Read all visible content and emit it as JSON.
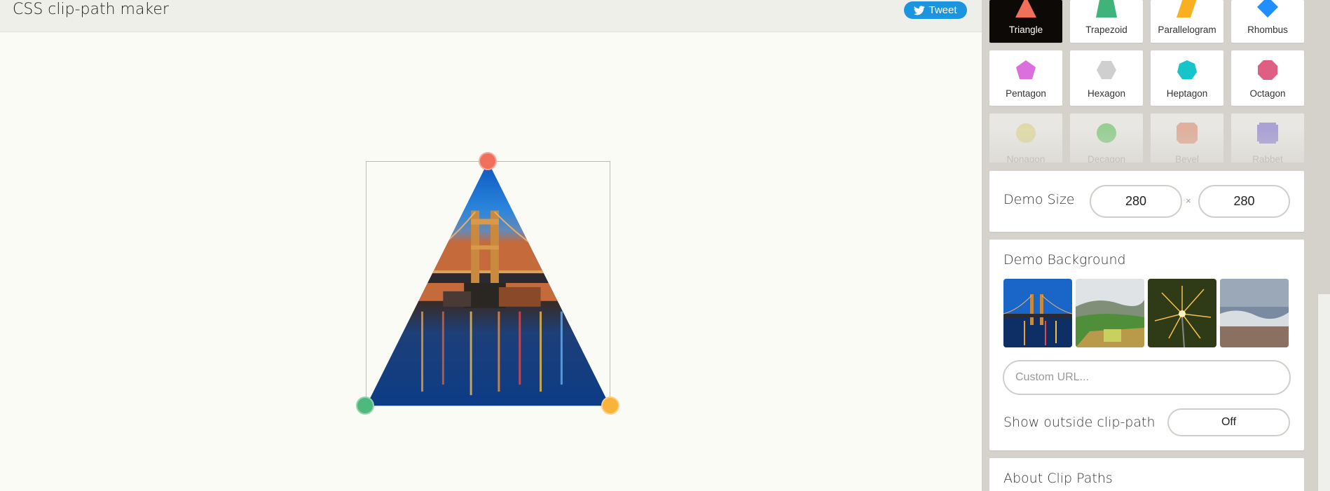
{
  "header": {
    "title": "CSS clip-path maker",
    "tweet_label": "Tweet"
  },
  "shapes": [
    {
      "label": "Triangle",
      "color": "#f0705b",
      "icon": "triangle-icon",
      "active": true
    },
    {
      "label": "Trapezoid",
      "color": "#3fb37a",
      "icon": "trapezoid-icon"
    },
    {
      "label": "Parallelogram",
      "color": "#f8b020",
      "icon": "parallelogram-icon"
    },
    {
      "label": "Rhombus",
      "color": "#1f8fff",
      "icon": "rhombus-icon"
    },
    {
      "label": "Pentagon",
      "color": "#db6fdd",
      "icon": "pentagon-icon"
    },
    {
      "label": "Hexagon",
      "color": "#cfcfcf",
      "icon": "hexagon-icon"
    },
    {
      "label": "Heptagon",
      "color": "#17c4c9",
      "icon": "heptagon-icon"
    },
    {
      "label": "Octagon",
      "color": "#de5f82",
      "icon": "octagon-icon"
    },
    {
      "label": "Nonagon",
      "color": "#efe38a",
      "icon": "nonagon-icon"
    },
    {
      "label": "Decagon",
      "color": "#56cc58",
      "icon": "decagon-icon"
    },
    {
      "label": "Bevel",
      "color": "#ef8a6d",
      "icon": "bevel-icon"
    },
    {
      "label": "Rabbet",
      "color": "#7d6ee0",
      "icon": "rabbet-icon"
    }
  ],
  "demo_size": {
    "title": "Demo Size",
    "width": "280",
    "height": "280",
    "separator": "×"
  },
  "demo_background": {
    "title": "Demo Background",
    "thumbnails": [
      "bridge-night",
      "green-hills",
      "sparkler",
      "ocean-waves"
    ],
    "custom_url_placeholder": "Custom URL...",
    "show_outside_label": "Show outside clip-path",
    "show_outside_value": "Off"
  },
  "about": {
    "title": "About Clip Paths"
  },
  "handles": [
    {
      "name": "top",
      "color": "#f0705b"
    },
    {
      "name": "bottom-left",
      "color": "#4fb87c"
    },
    {
      "name": "bottom-right",
      "color": "#f8b33a"
    }
  ]
}
